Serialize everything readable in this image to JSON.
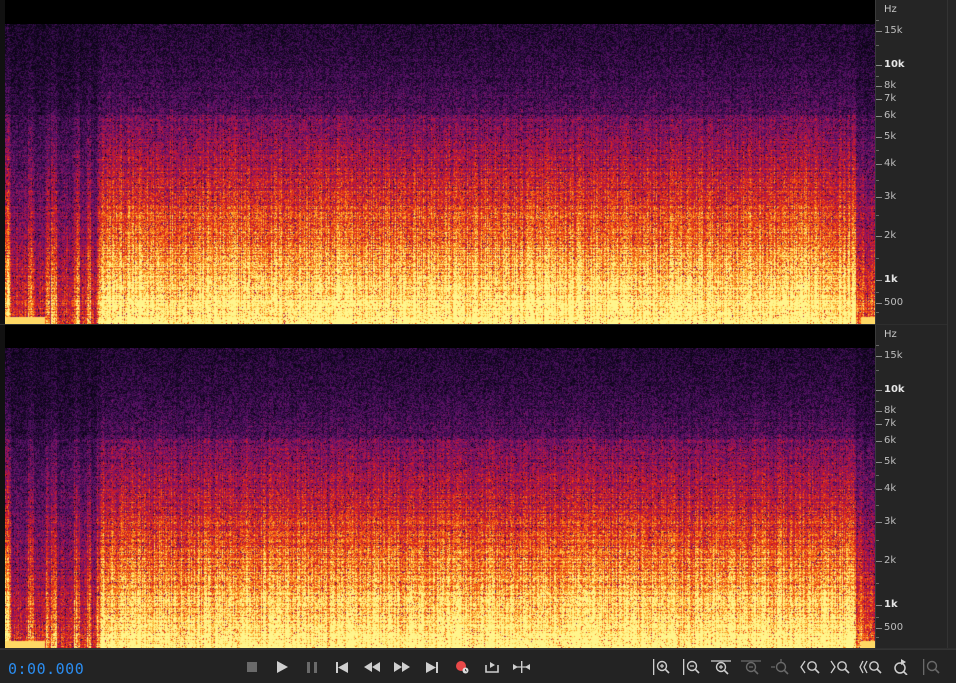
{
  "channels": [
    {
      "ruler": {
        "unit": "Hz",
        "labels": [
          "15k",
          "10k",
          "8k",
          "7k",
          "6k",
          "5k",
          "4k",
          "3k",
          "2k",
          "1k",
          "500"
        ]
      }
    },
    {
      "ruler": {
        "unit": "Hz",
        "labels": [
          "15k",
          "10k",
          "8k",
          "7k",
          "6k",
          "5k",
          "4k",
          "3k",
          "2k",
          "1k",
          "500"
        ]
      }
    }
  ],
  "transport": {
    "time": "0:00.000"
  },
  "icons": {
    "stop": "stop-icon",
    "play": "play-icon",
    "pause": "pause-icon",
    "to_start": "skip-to-start-icon",
    "rewind": "rewind-icon",
    "fast_forward": "fast-forward-icon",
    "to_end": "skip-to-end-icon",
    "record": "record-icon",
    "loop": "loop-playback-icon",
    "skip": "skip-selection-icon",
    "zoom_in_amp": "zoom-in-amplitude-icon",
    "zoom_out_amp": "zoom-out-amplitude-icon",
    "zoom_in_time": "zoom-in-time-icon",
    "zoom_out_full": "zoom-out-full-icon",
    "zoom_selection": "zoom-to-selection-icon",
    "zoom_in_point": "zoom-in-at-start-icon",
    "zoom_out_point": "zoom-in-at-end-icon",
    "zoom_full": "zoom-out-full-both-icon",
    "reset_zoom": "reset-zoom-icon",
    "zoom_extra": "zoom-menu-icon"
  },
  "colors": {
    "timecode": "#2b8df0",
    "record": "#e84848"
  }
}
